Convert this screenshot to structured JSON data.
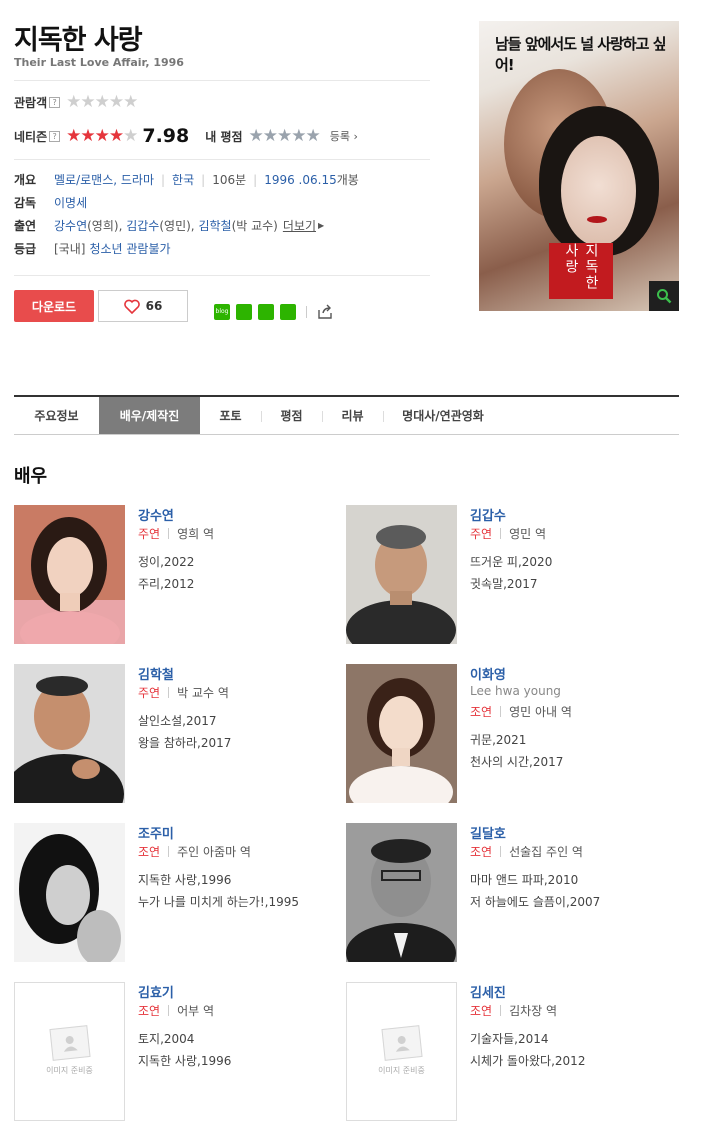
{
  "movie": {
    "title": "지독한 사랑",
    "subtitle": "Their Last Love Affair, 1996"
  },
  "ratings": {
    "audience_label": "관람객",
    "netizen_label": "네티즌",
    "netizen_score": "7.98",
    "netizen_stars_filled": 4,
    "my_rating_label": "내 평점",
    "register_label": "등록"
  },
  "info": {
    "overview_key": "개요",
    "genre": "멜로/로맨스, 드라마",
    "country": "한국",
    "runtime": "106분",
    "release_date": "1996 .06.15",
    "release_suffix": "개봉",
    "director_key": "감독",
    "director": "이명세",
    "cast_key": "출연",
    "cast": [
      {
        "name": "강수연",
        "role": "(영희)"
      },
      {
        "name": "김갑수",
        "role": "(영민)"
      },
      {
        "name": "김학철",
        "role": "(박 교수)"
      }
    ],
    "more_label": "더보기",
    "grade_key": "등급",
    "grade_prefix": "[국내]",
    "grade": "청소년 관람불가"
  },
  "actions": {
    "download_label": "다운로드",
    "like_count": "66"
  },
  "poster": {
    "tagline": "남들 앞에서도 널 사랑하고 싶어!",
    "title": "지독한사랑"
  },
  "tabs": [
    {
      "label": "주요정보",
      "active": false
    },
    {
      "label": "배우/제작진",
      "active": true
    },
    {
      "label": "포토",
      "active": false
    },
    {
      "label": "평점",
      "active": false
    },
    {
      "label": "리뷰",
      "active": false
    },
    {
      "label": "명대사/연관영화",
      "active": false
    }
  ],
  "section_title": "배우",
  "placeholder_text": "이미지 준비중",
  "actors": [
    {
      "name": "강수연",
      "english": "",
      "role_type": "주연",
      "role": "영희 역",
      "works": [
        "정이,2022",
        "주리,2012"
      ]
    },
    {
      "name": "김갑수",
      "english": "",
      "role_type": "주연",
      "role": "영민 역",
      "works": [
        "뜨거운 피,2020",
        "귓속말,2017"
      ]
    },
    {
      "name": "김학철",
      "english": "",
      "role_type": "주연",
      "role": "박 교수 역",
      "works": [
        "살인소설,2017",
        "왕을 참하라,2017"
      ]
    },
    {
      "name": "이화영",
      "english": "Lee hwa young",
      "role_type": "조연",
      "role": "영민 아내 역",
      "works": [
        "귀문,2021",
        "천사의 시간,2017"
      ]
    },
    {
      "name": "조주미",
      "english": "",
      "role_type": "조연",
      "role": "주인 아줌마 역",
      "works": [
        "지독한 사랑,1996",
        "누가 나를 미치게 하는가!,1995"
      ]
    },
    {
      "name": "길달호",
      "english": "",
      "role_type": "조연",
      "role": "선술집 주인 역",
      "works": [
        "마마 앤드 파파,2010",
        "저 하늘에도 슬픔이,2007"
      ]
    },
    {
      "name": "김효기",
      "english": "",
      "role_type": "조연",
      "role": "어부 역",
      "works": [
        "토지,2004",
        "지독한 사랑,1996"
      ]
    },
    {
      "name": "김세진",
      "english": "",
      "role_type": "조연",
      "role": "김차장 역",
      "works": [
        "기술자들,2014",
        "시체가 돌아왔다,2012"
      ]
    }
  ]
}
